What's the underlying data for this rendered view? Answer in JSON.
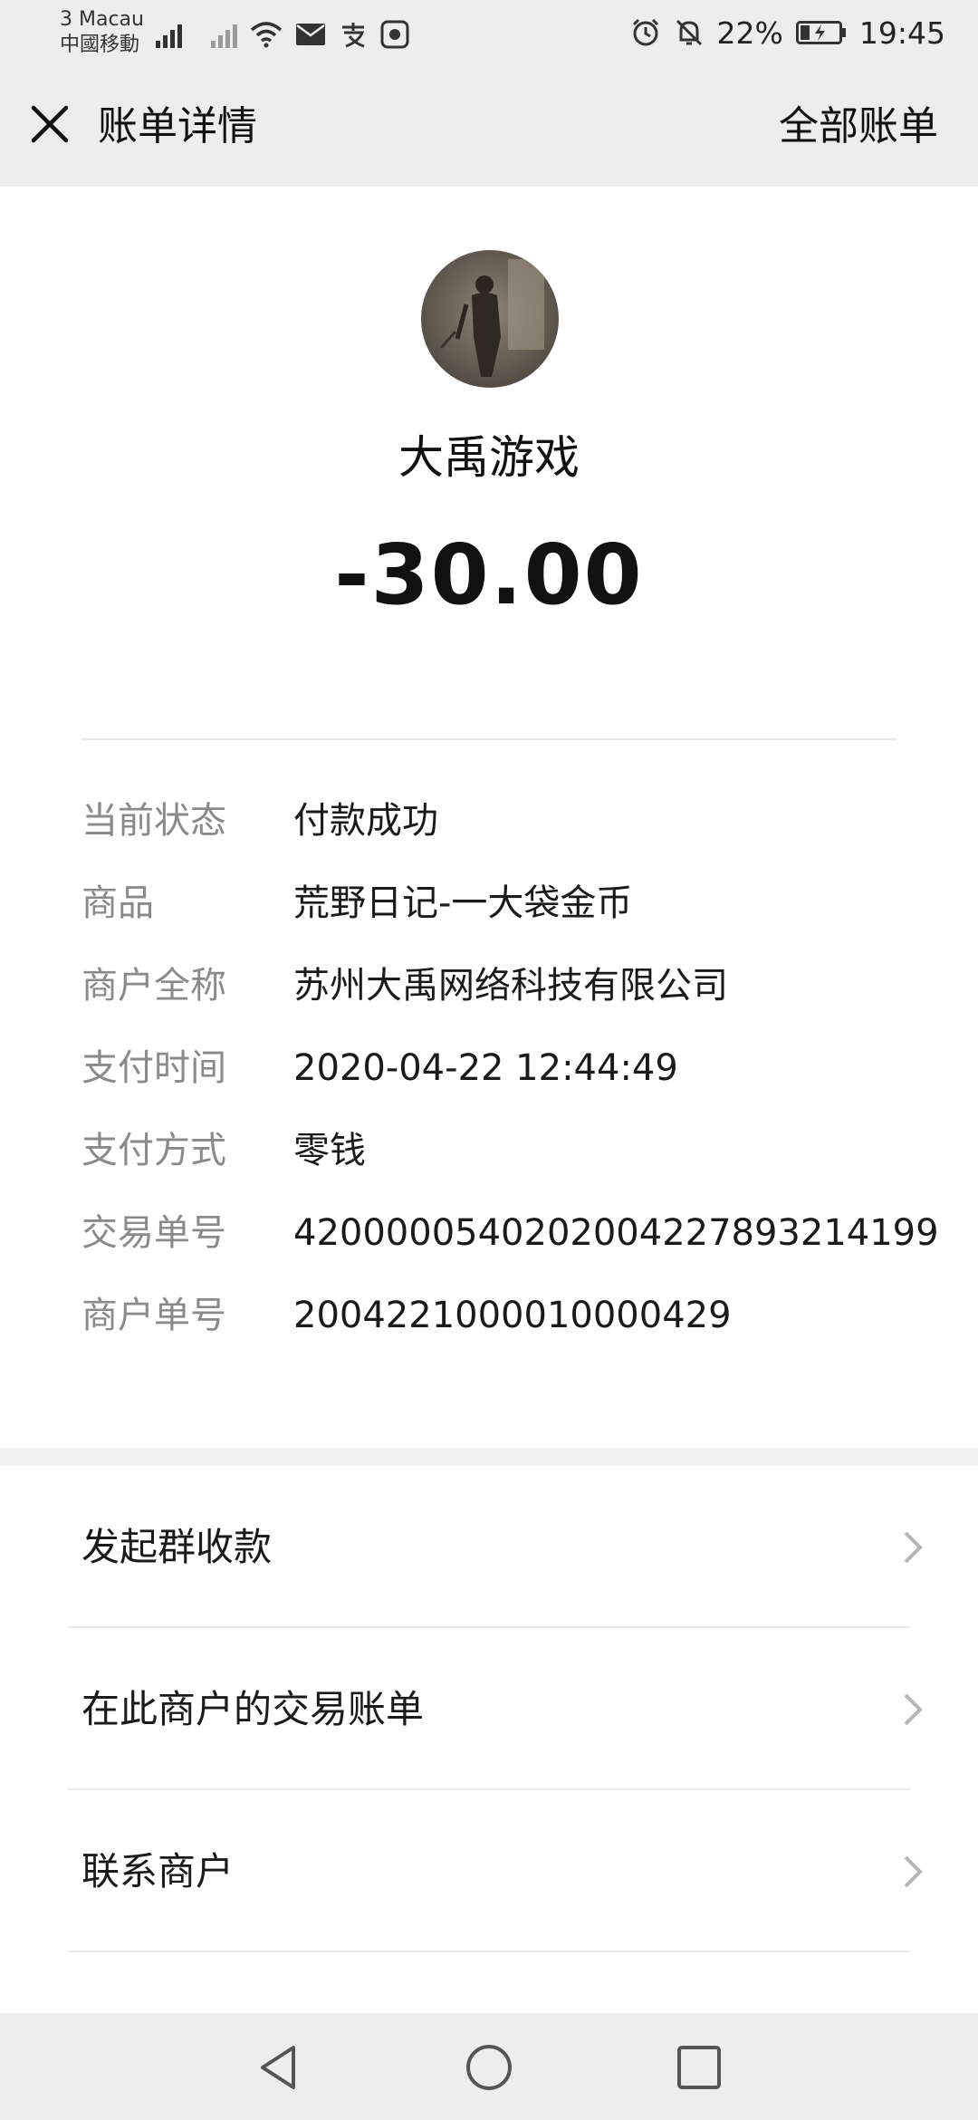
{
  "status_bar": {
    "carrier_line1": "3 Macau",
    "carrier_line2": "中國移動",
    "battery": "22%",
    "time": "19:45"
  },
  "header": {
    "title": "账单详情",
    "right_action": "全部账单"
  },
  "merchant": {
    "name": "大禹游戏",
    "amount": "-30.00"
  },
  "details": [
    {
      "label": "当前状态",
      "value": "付款成功"
    },
    {
      "label": "商品",
      "value": "荒野日记-一大袋金币"
    },
    {
      "label": "商户全称",
      "value": "苏州大禹网络科技有限公司"
    },
    {
      "label": "支付时间",
      "value": "2020-04-22 12:44:49"
    },
    {
      "label": "支付方式",
      "value": "零钱"
    },
    {
      "label": "交易单号",
      "value": "4200000540202004227893214199"
    },
    {
      "label": "商户单号",
      "value": "2004221000010000429"
    }
  ],
  "actions": [
    {
      "label": "发起群收款"
    },
    {
      "label": "在此商户的交易账单"
    },
    {
      "label": "联系商户"
    }
  ]
}
